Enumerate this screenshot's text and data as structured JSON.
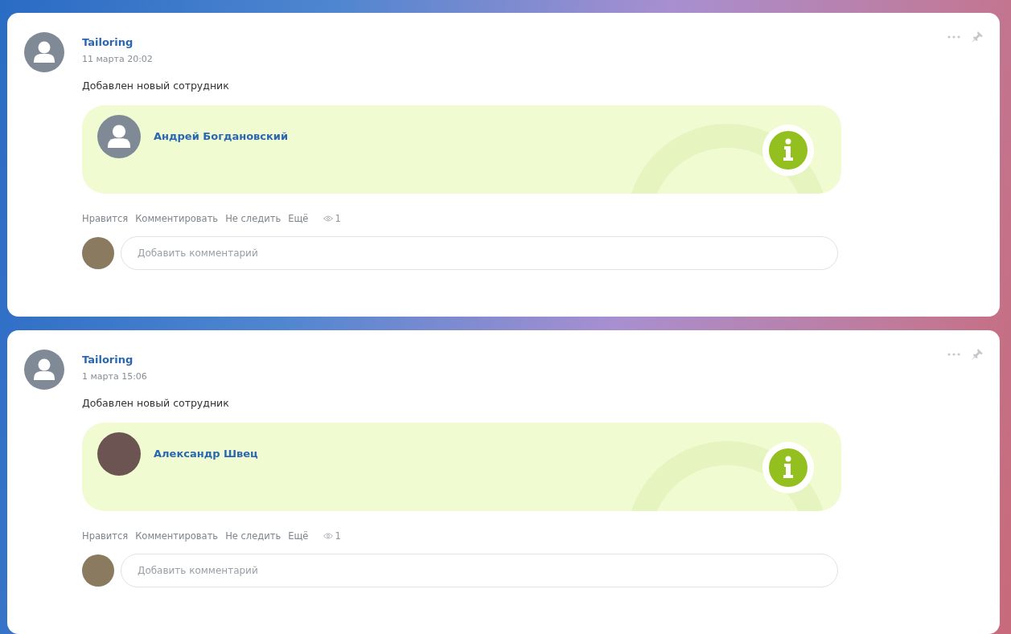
{
  "posts": [
    {
      "author": "Tailoring",
      "date": "11 марта 20:02",
      "text": "Добавлен новый сотрудник",
      "employee": {
        "name": "Андрей Богдановский",
        "kind": "silhouette"
      },
      "actions": [
        "Нравится",
        "Комментировать",
        "Не следить",
        "Ещё"
      ],
      "views": "1",
      "comment": {
        "placeholder": "Добавить комментарий"
      }
    },
    {
      "author": "Tailoring",
      "date": "1 марта 15:06",
      "text": "Добавлен новый сотрудник",
      "employee": {
        "name": "Александр Швец",
        "kind": "photo"
      },
      "actions": [
        "Нравится",
        "Комментировать",
        "Не следить",
        "Ещё"
      ],
      "views": "1",
      "comment": {
        "placeholder": "Добавить комментарий"
      }
    }
  ]
}
